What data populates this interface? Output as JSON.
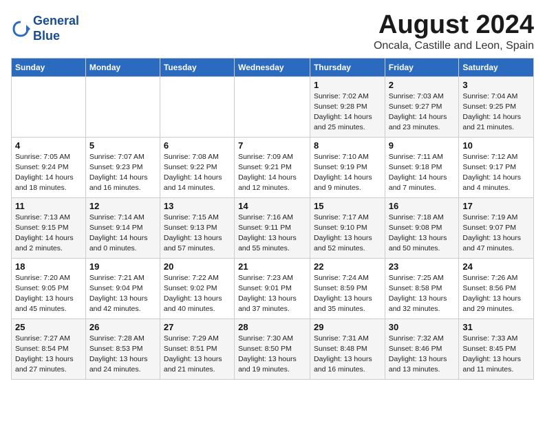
{
  "header": {
    "logo_line1": "General",
    "logo_line2": "Blue",
    "month": "August 2024",
    "location": "Oncala, Castille and Leon, Spain"
  },
  "weekdays": [
    "Sunday",
    "Monday",
    "Tuesday",
    "Wednesday",
    "Thursday",
    "Friday",
    "Saturday"
  ],
  "weeks": [
    [
      {
        "day": "",
        "info": ""
      },
      {
        "day": "",
        "info": ""
      },
      {
        "day": "",
        "info": ""
      },
      {
        "day": "",
        "info": ""
      },
      {
        "day": "1",
        "info": "Sunrise: 7:02 AM\nSunset: 9:28 PM\nDaylight: 14 hours\nand 25 minutes."
      },
      {
        "day": "2",
        "info": "Sunrise: 7:03 AM\nSunset: 9:27 PM\nDaylight: 14 hours\nand 23 minutes."
      },
      {
        "day": "3",
        "info": "Sunrise: 7:04 AM\nSunset: 9:25 PM\nDaylight: 14 hours\nand 21 minutes."
      }
    ],
    [
      {
        "day": "4",
        "info": "Sunrise: 7:05 AM\nSunset: 9:24 PM\nDaylight: 14 hours\nand 18 minutes."
      },
      {
        "day": "5",
        "info": "Sunrise: 7:07 AM\nSunset: 9:23 PM\nDaylight: 14 hours\nand 16 minutes."
      },
      {
        "day": "6",
        "info": "Sunrise: 7:08 AM\nSunset: 9:22 PM\nDaylight: 14 hours\nand 14 minutes."
      },
      {
        "day": "7",
        "info": "Sunrise: 7:09 AM\nSunset: 9:21 PM\nDaylight: 14 hours\nand 12 minutes."
      },
      {
        "day": "8",
        "info": "Sunrise: 7:10 AM\nSunset: 9:19 PM\nDaylight: 14 hours\nand 9 minutes."
      },
      {
        "day": "9",
        "info": "Sunrise: 7:11 AM\nSunset: 9:18 PM\nDaylight: 14 hours\nand 7 minutes."
      },
      {
        "day": "10",
        "info": "Sunrise: 7:12 AM\nSunset: 9:17 PM\nDaylight: 14 hours\nand 4 minutes."
      }
    ],
    [
      {
        "day": "11",
        "info": "Sunrise: 7:13 AM\nSunset: 9:15 PM\nDaylight: 14 hours\nand 2 minutes."
      },
      {
        "day": "12",
        "info": "Sunrise: 7:14 AM\nSunset: 9:14 PM\nDaylight: 14 hours\nand 0 minutes."
      },
      {
        "day": "13",
        "info": "Sunrise: 7:15 AM\nSunset: 9:13 PM\nDaylight: 13 hours\nand 57 minutes."
      },
      {
        "day": "14",
        "info": "Sunrise: 7:16 AM\nSunset: 9:11 PM\nDaylight: 13 hours\nand 55 minutes."
      },
      {
        "day": "15",
        "info": "Sunrise: 7:17 AM\nSunset: 9:10 PM\nDaylight: 13 hours\nand 52 minutes."
      },
      {
        "day": "16",
        "info": "Sunrise: 7:18 AM\nSunset: 9:08 PM\nDaylight: 13 hours\nand 50 minutes."
      },
      {
        "day": "17",
        "info": "Sunrise: 7:19 AM\nSunset: 9:07 PM\nDaylight: 13 hours\nand 47 minutes."
      }
    ],
    [
      {
        "day": "18",
        "info": "Sunrise: 7:20 AM\nSunset: 9:05 PM\nDaylight: 13 hours\nand 45 minutes."
      },
      {
        "day": "19",
        "info": "Sunrise: 7:21 AM\nSunset: 9:04 PM\nDaylight: 13 hours\nand 42 minutes."
      },
      {
        "day": "20",
        "info": "Sunrise: 7:22 AM\nSunset: 9:02 PM\nDaylight: 13 hours\nand 40 minutes."
      },
      {
        "day": "21",
        "info": "Sunrise: 7:23 AM\nSunset: 9:01 PM\nDaylight: 13 hours\nand 37 minutes."
      },
      {
        "day": "22",
        "info": "Sunrise: 7:24 AM\nSunset: 8:59 PM\nDaylight: 13 hours\nand 35 minutes."
      },
      {
        "day": "23",
        "info": "Sunrise: 7:25 AM\nSunset: 8:58 PM\nDaylight: 13 hours\nand 32 minutes."
      },
      {
        "day": "24",
        "info": "Sunrise: 7:26 AM\nSunset: 8:56 PM\nDaylight: 13 hours\nand 29 minutes."
      }
    ],
    [
      {
        "day": "25",
        "info": "Sunrise: 7:27 AM\nSunset: 8:54 PM\nDaylight: 13 hours\nand 27 minutes."
      },
      {
        "day": "26",
        "info": "Sunrise: 7:28 AM\nSunset: 8:53 PM\nDaylight: 13 hours\nand 24 minutes."
      },
      {
        "day": "27",
        "info": "Sunrise: 7:29 AM\nSunset: 8:51 PM\nDaylight: 13 hours\nand 21 minutes."
      },
      {
        "day": "28",
        "info": "Sunrise: 7:30 AM\nSunset: 8:50 PM\nDaylight: 13 hours\nand 19 minutes."
      },
      {
        "day": "29",
        "info": "Sunrise: 7:31 AM\nSunset: 8:48 PM\nDaylight: 13 hours\nand 16 minutes."
      },
      {
        "day": "30",
        "info": "Sunrise: 7:32 AM\nSunset: 8:46 PM\nDaylight: 13 hours\nand 13 minutes."
      },
      {
        "day": "31",
        "info": "Sunrise: 7:33 AM\nSunset: 8:45 PM\nDaylight: 13 hours\nand 11 minutes."
      }
    ]
  ]
}
